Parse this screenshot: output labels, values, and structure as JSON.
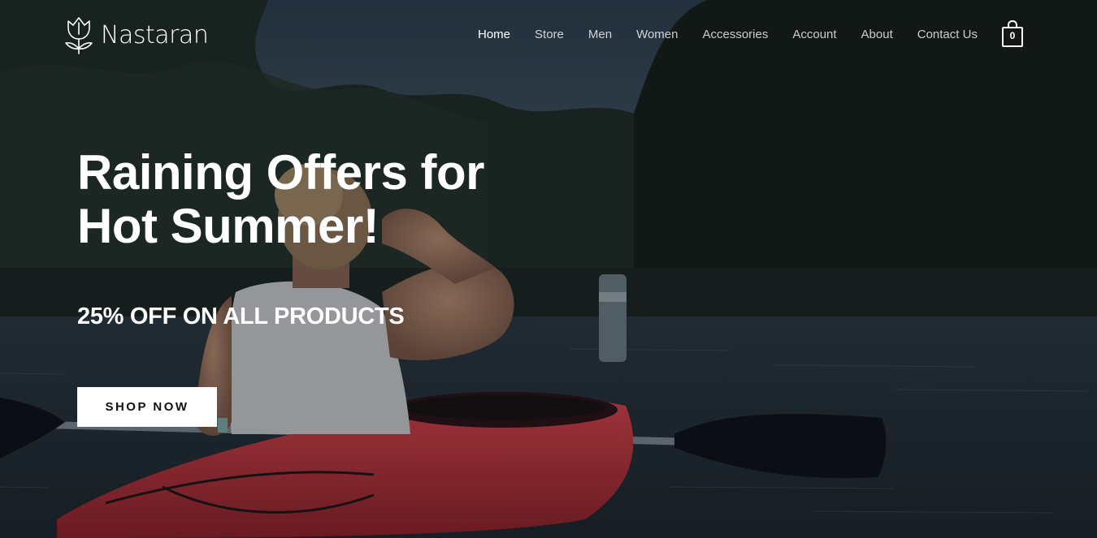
{
  "brand": {
    "name": "Nastaran",
    "icon": "tulip-logo-icon"
  },
  "nav": {
    "items": [
      {
        "label": "Home",
        "active": true
      },
      {
        "label": "Store",
        "active": false
      },
      {
        "label": "Men",
        "active": false
      },
      {
        "label": "Women",
        "active": false
      },
      {
        "label": "Accessories",
        "active": false
      },
      {
        "label": "Account",
        "active": false
      },
      {
        "label": "About",
        "active": false
      },
      {
        "label": "Contact Us",
        "active": false
      }
    ]
  },
  "cart": {
    "count": "0",
    "icon": "shopping-bag-icon"
  },
  "hero": {
    "headline_line1": "Raining Offers for",
    "headline_line2": "Hot Summer!",
    "subheadline": "25% OFF ON ALL PRODUCTS",
    "cta_label": "SHOP NOW",
    "image": "woman-in-red-kayak-on-lake-photo"
  },
  "colors": {
    "text": "#ffffff",
    "button_bg": "#ffffff",
    "button_text": "#111111",
    "kayak_red": "#c8303a"
  }
}
